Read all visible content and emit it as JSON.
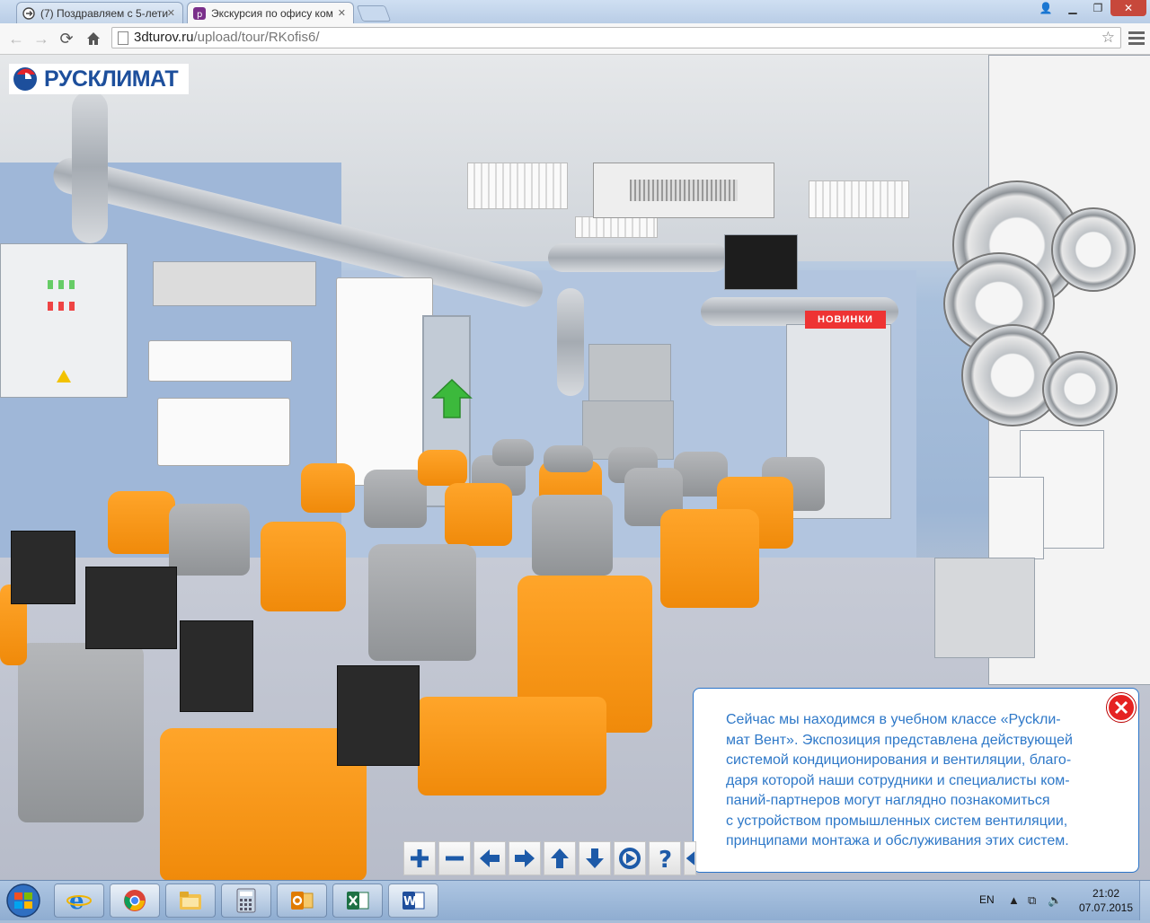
{
  "browser": {
    "tabs": [
      {
        "title": "(7) Поздравляем с 5-лети",
        "active": false
      },
      {
        "title": "Экскурсия по офису ком",
        "active": true
      }
    ],
    "url_host": "3dturov.ru",
    "url_path": "/upload/tour/RKofis6/"
  },
  "tour": {
    "logo_text": "РУСКЛИМАТ",
    "badge_text": "НОВИНКИ",
    "info_lines": [
      "Сейчас мы находимся в учебном классе «Русkли-",
      "мат Вент». Экспозиция представлена действующей",
      "системой кондиционирования и вентиляции, благо-",
      "даря которой наши сотрудники и специалисты ком-",
      "паний-партнеров могут наглядно познакомиться",
      "с устройством промышленных систем вентиляции,",
      "принципами монтажа и обслуживания этих систем."
    ],
    "controls": [
      "zoom-in",
      "zoom-out",
      "pan-left",
      "pan-right",
      "pan-up",
      "pan-down",
      "autorotate",
      "help",
      "back"
    ],
    "colors": {
      "info_text": "#2e78c8",
      "info_border": "#2a74c9",
      "close": "#e52222",
      "chair_orange": "#f7941d",
      "arrow_green": "#3cb93c"
    }
  },
  "taskbar": {
    "apps": [
      "internet-explorer",
      "chrome",
      "file-explorer",
      "calculator",
      "outlook",
      "excel",
      "word"
    ],
    "language": "EN",
    "time": "21:02",
    "date": "07.07.2015"
  }
}
